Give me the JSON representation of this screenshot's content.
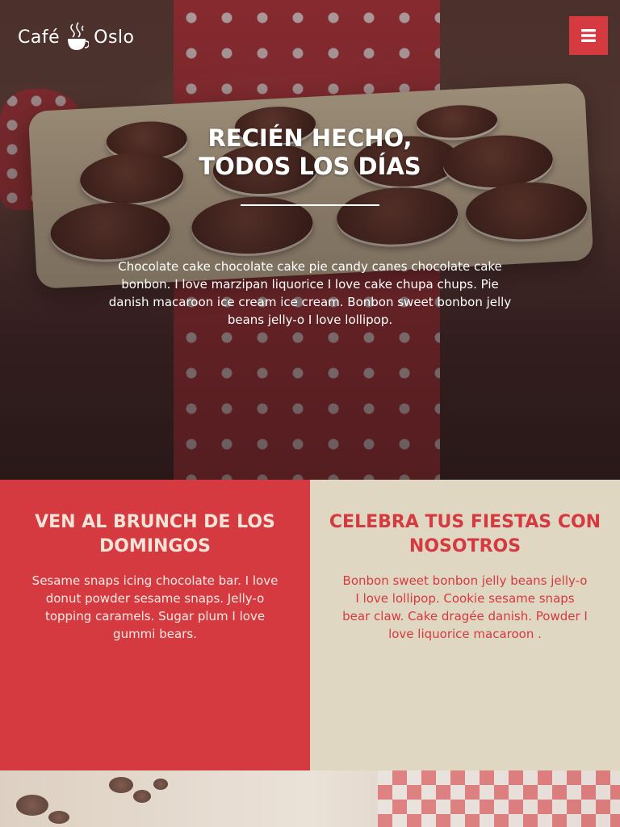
{
  "brand": {
    "name_left": "Café",
    "name_right": "Oslo",
    "icon": "coffee-cup-icon"
  },
  "header": {
    "menu_icon": "hamburger-menu-icon",
    "menu_color": "#d43a40"
  },
  "hero": {
    "title_line1": "RECIÉN HECHO,",
    "title_line2": "TODOS LOS DÍAS",
    "text": "Chocolate cake chocolate cake pie candy canes chocolate cake bonbon. I love marzipan liquorice I love cake chupa chups. Pie danish macaroon ice cream ice cream. Bonbon sweet bonbon jelly beans jelly-o I love lollipop."
  },
  "panels": [
    {
      "title": "VEN AL BRUNCH DE LOS DOMINGOS",
      "text": "Sesame snaps icing chocolate bar. I love donut powder sesame snaps. Jelly-o topping caramels. Sugar plum I love gummi bears.",
      "background": "#d43a40"
    },
    {
      "title": "CELEBRA TUS FIESTAS CON NOSOTROS",
      "text": "Bonbon sweet bonbon jelly beans jelly-o I love lollipop. Cookie sesame snaps bear claw. Cake dragée danish. Powder I love liquorice macaroon .",
      "background": "#e0d7c3"
    }
  ],
  "colors": {
    "accent": "#d43a40",
    "beige": "#e0d7c3"
  }
}
